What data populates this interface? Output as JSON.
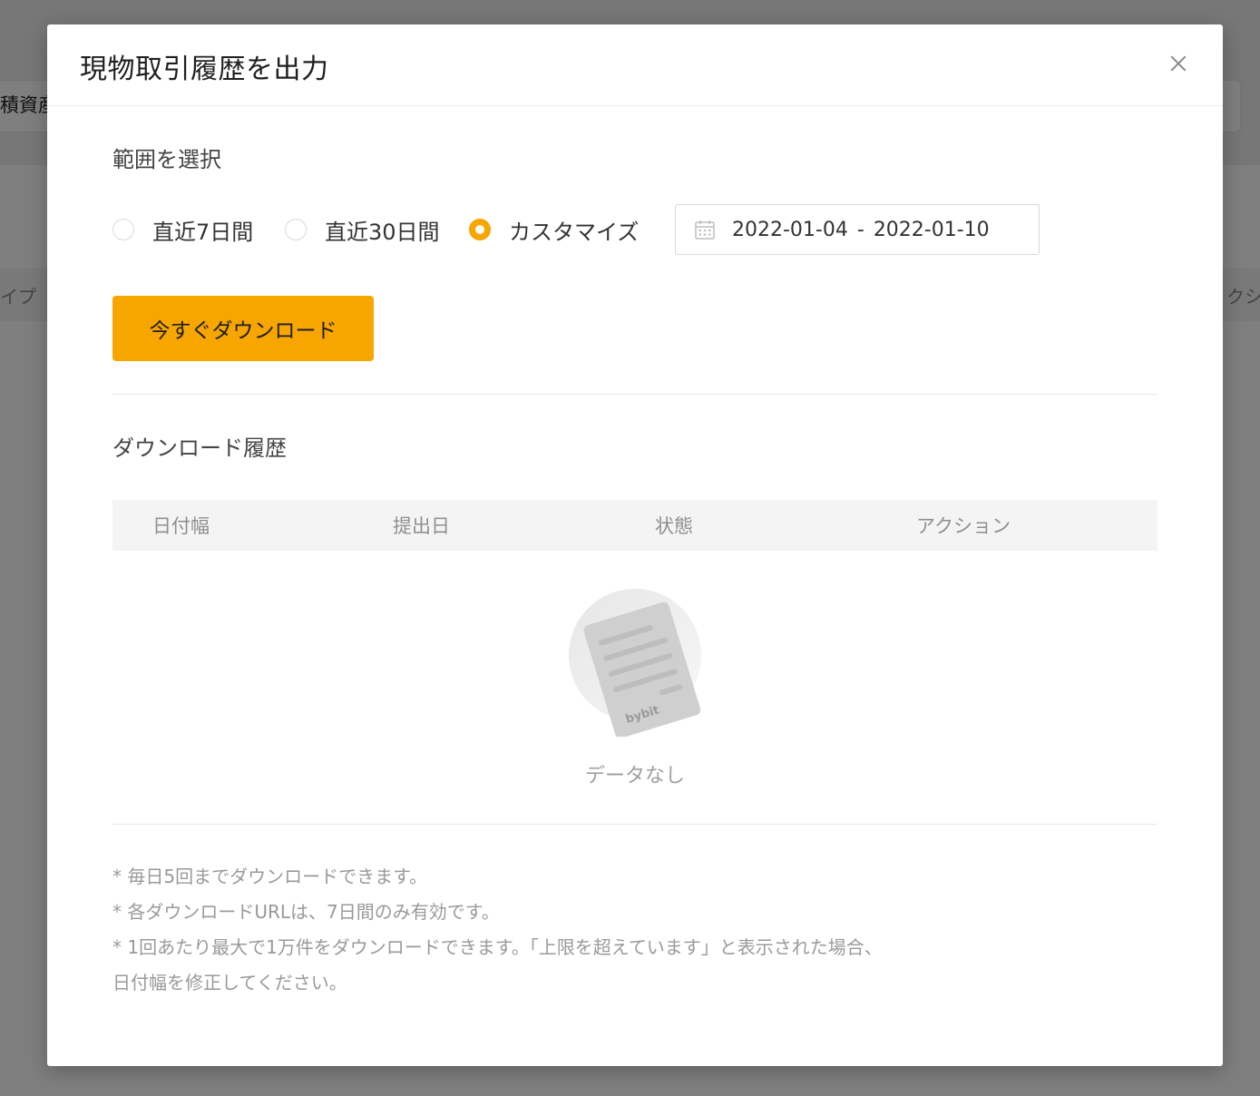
{
  "background": {
    "asset_label": "積資産",
    "table_col_left": "イプ",
    "table_col_right": "クショ"
  },
  "modal": {
    "title": "現物取引履歴を出力",
    "range_section_title": "範囲を選択",
    "range_options": [
      {
        "label": "直近7日間",
        "checked": false
      },
      {
        "label": "直近30日間",
        "checked": false
      },
      {
        "label": "カスタマイズ",
        "checked": true
      }
    ],
    "date_range": {
      "start": "2022-01-04",
      "separator": "-",
      "end": "2022-01-10"
    },
    "download_button": "今すぐダウンロード",
    "history_section_title": "ダウンロード履歴",
    "table_headers": [
      "日付幅",
      "提出日",
      "状態",
      "アクション"
    ],
    "empty_text": "データなし",
    "empty_illustration_brand": "bybit",
    "notes": [
      "* 毎日5回までダウンロードできます。",
      "* 各ダウンロードURLは、7日間のみ有効です。",
      "* 1回あたり最大で1万件をダウンロードできます。「上限を超えています」と表示された場合、",
      "日付幅を修正してください。"
    ]
  },
  "colors": {
    "accent": "#f7a600",
    "overlay": "rgba(0,0,0,0.5)"
  },
  "icons": {
    "close": "close-icon",
    "calendar": "calendar-icon",
    "empty": "empty-document-icon"
  }
}
